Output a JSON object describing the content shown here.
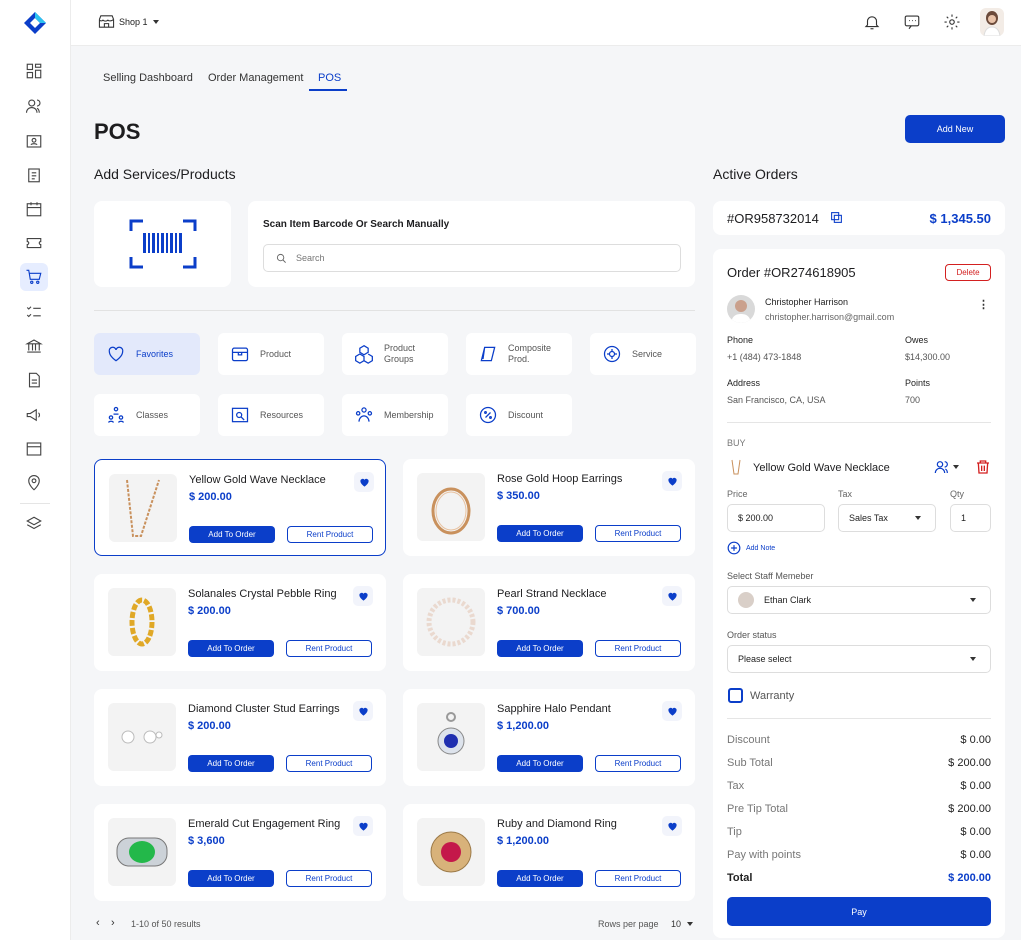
{
  "header": {
    "shop": "Shop 1"
  },
  "tabs": [
    "Selling Dashboard",
    "Order Management",
    "POS"
  ],
  "page_title": "POS",
  "add_new": "Add New",
  "left": {
    "section_title": "Add Services/Products",
    "scan_title": "Scan Item Barcode Or Search Manually",
    "search_placeholder": "Search",
    "categories": [
      "Favorites",
      "Product",
      "Product Groups",
      "Composite Prod.",
      "Service",
      "Classes",
      "Resources",
      "Membership",
      "Discount"
    ],
    "add_label": "Add To Order",
    "rent_label": "Rent Product",
    "products": [
      {
        "name": "Yellow Gold Wave Necklace",
        "price": "$ 200.00"
      },
      {
        "name": "Rose Gold Hoop Earrings",
        "price": "$ 350.00"
      },
      {
        "name": "Solanales Crystal Pebble Ring",
        "price": "$ 200.00"
      },
      {
        "name": "Pearl Strand Necklace",
        "price": "$ 700.00"
      },
      {
        "name": "Diamond Cluster Stud Earrings",
        "price": "$ 200.00"
      },
      {
        "name": "Sapphire Halo Pendant",
        "price": "$ 1,200.00"
      },
      {
        "name": "Emerald Cut Engagement Ring",
        "price": "$ 3,600"
      },
      {
        "name": "Ruby and Diamond  Ring",
        "price": "$ 1,200.00"
      }
    ],
    "pagination": {
      "results": "1-10 of 50 results",
      "rows_label": "Rows per page",
      "rows_value": "10"
    }
  },
  "right": {
    "section_title": "Active Orders",
    "active_order": {
      "id": "#OR958732014",
      "amount": "$ 1,345.50"
    },
    "order": {
      "title": "Order #OR274618905",
      "delete": "Delete",
      "customer": {
        "name": "Christopher Harrison",
        "email": "christopher.harrison@gmail.com"
      },
      "phone_label": "Phone",
      "phone": "+1 (484) 473-1848",
      "owes_label": "Owes",
      "owes": "$14,300.00",
      "address_label": "Address",
      "address": "San Francisco, CA, USA",
      "points_label": "Points",
      "points": "700",
      "buy_label": "BUY",
      "item": "Yellow Gold Wave Necklace",
      "price_label": "Price",
      "price": "$ 200.00",
      "tax_label": "Tax",
      "tax": "Sales Tax",
      "qty_label": "Qty",
      "qty": "1",
      "add_note": "Add Note",
      "staff_label": "Select Staff Memeber",
      "staff": "Ethan Clark",
      "status_label": "Order status",
      "status": "Please select",
      "warranty": "Warranty",
      "summary": [
        {
          "label": "Discount",
          "value": "$ 0.00"
        },
        {
          "label": "Sub Total",
          "value": "$ 200.00"
        },
        {
          "label": "Tax",
          "value": "$ 0.00"
        },
        {
          "label": "Pre Tip Total",
          "value": "$ 200.00"
        },
        {
          "label": "Tip",
          "value": "$ 0.00"
        },
        {
          "label": "Pay with points",
          "value": "$ 0.00"
        }
      ],
      "total_label": "Total",
      "total": "$ 200.00",
      "pay": "Pay"
    }
  }
}
